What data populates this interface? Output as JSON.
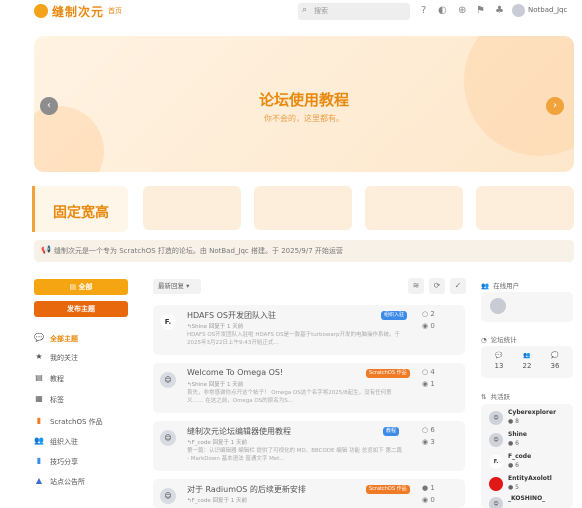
{
  "header": {
    "logo_text": "缝制次元",
    "logo_sub": "首页",
    "search_placeholder": "搜索",
    "user_name": "Notbad_Jqc",
    "icons": [
      "help-icon",
      "theme-icon",
      "grid-icon",
      "flag-icon",
      "bell-icon"
    ]
  },
  "hero": {
    "title": "论坛使用教程",
    "subtitle": "你不会的，这里都有。",
    "prev": "‹",
    "next": "›"
  },
  "featured": {
    "first_title": "固定宽高"
  },
  "notice": {
    "text": "缝制次元是一个专为 ScratchOS 打造的论坛。由 NotBad_Jqc 搭建。于 2025/9/7 开始运营"
  },
  "sidebar": {
    "all_topics_btn": "全部",
    "new_topic_btn": "发布主题",
    "items": [
      {
        "label": "全部主题",
        "icon": "💬",
        "active": true
      },
      {
        "label": "我的关注",
        "icon": "★",
        "active": false
      },
      {
        "label": "教程",
        "icon": "▤",
        "active": false
      },
      {
        "label": "标签",
        "icon": "▦",
        "active": false
      },
      {
        "label": "ScratchOS 作品",
        "icon": "▮",
        "active": false
      },
      {
        "label": "组织入驻",
        "icon": "👥",
        "active": false
      },
      {
        "label": "技巧分享",
        "icon": "▮",
        "active": false
      },
      {
        "label": "站点公告所",
        "icon": "▲",
        "active": false
      }
    ]
  },
  "toolbar": {
    "sort_label": "最新回复 ▾",
    "rss": "≋",
    "refresh": "⟳",
    "mark_read": "✓"
  },
  "topics": [
    {
      "avatar": "F.",
      "title": "HDAFS OS开发团队入驻",
      "meta": "↰Shine 回复于 1 天前",
      "excerpt": "HDAFS OS开发团队入驻啦 HDAFS OS是一款基于turbowarp开发的电脑操作系统。于2025年3月22日上午9:43开始正式…",
      "tag": "组织入驻",
      "tag_color": "#3d8be8",
      "replies": "2",
      "views": "0"
    },
    {
      "avatar": "☺",
      "title": "Welcome To Omega OS!",
      "meta": "↰Shine 回复于 1 天前",
      "excerpt": "首先，非常感谢你点开这个帖子！ Omega OS这个名字将2025/8起生，没有任何意义…… 在这之前，Omega OS的原名为S…",
      "tag": "ScratchOS 作品",
      "tag_color": "#f07b26",
      "replies": "4",
      "views": "1"
    },
    {
      "avatar": "☺",
      "title": "缝制次元论坛编辑器使用教程",
      "meta": "↰F_code 回复于 1 天前",
      "excerpt": "第一篇：认识编辑器 编辑栏 提供了可视化的 MD、BBCODE 编辑 功能 总览如下 第二篇 - MarkDown 基本语法 普通文字 Met…",
      "tag": "教程",
      "tag_color": "#3d8be8",
      "replies": "6",
      "views": "3"
    },
    {
      "avatar": "☺",
      "title": "对于 RadiumOS 的后续更新安排",
      "meta": "↰F_code 回复于 1 天前",
      "excerpt": "",
      "tag": "ScratchOS 作品",
      "tag_color": "#f07b26",
      "replies": "1",
      "views": "0"
    }
  ],
  "right": {
    "online_title": "在线用户",
    "stats_title": "论坛统计",
    "stats": [
      {
        "icon": "💬",
        "value": "13"
      },
      {
        "icon": "👥",
        "value": "22"
      },
      {
        "icon": "💭",
        "value": "36"
      }
    ],
    "rank_title": "共活跃",
    "rank": [
      {
        "name": "Cyberexplorer",
        "score": "8",
        "avatar": "☺",
        "color": "#cfd2db"
      },
      {
        "name": "Shine",
        "score": "6",
        "avatar": "☺",
        "color": "#cfd2db"
      },
      {
        "name": "F_code",
        "score": "6",
        "avatar": "F.",
        "color": "#ffffff"
      },
      {
        "name": "EntityAxolotl",
        "score": "5",
        "avatar": "",
        "color": "#e01818"
      },
      {
        "name": "_KOSHINO_",
        "score": "",
        "avatar": "☺",
        "color": "#cfd2db"
      }
    ]
  }
}
